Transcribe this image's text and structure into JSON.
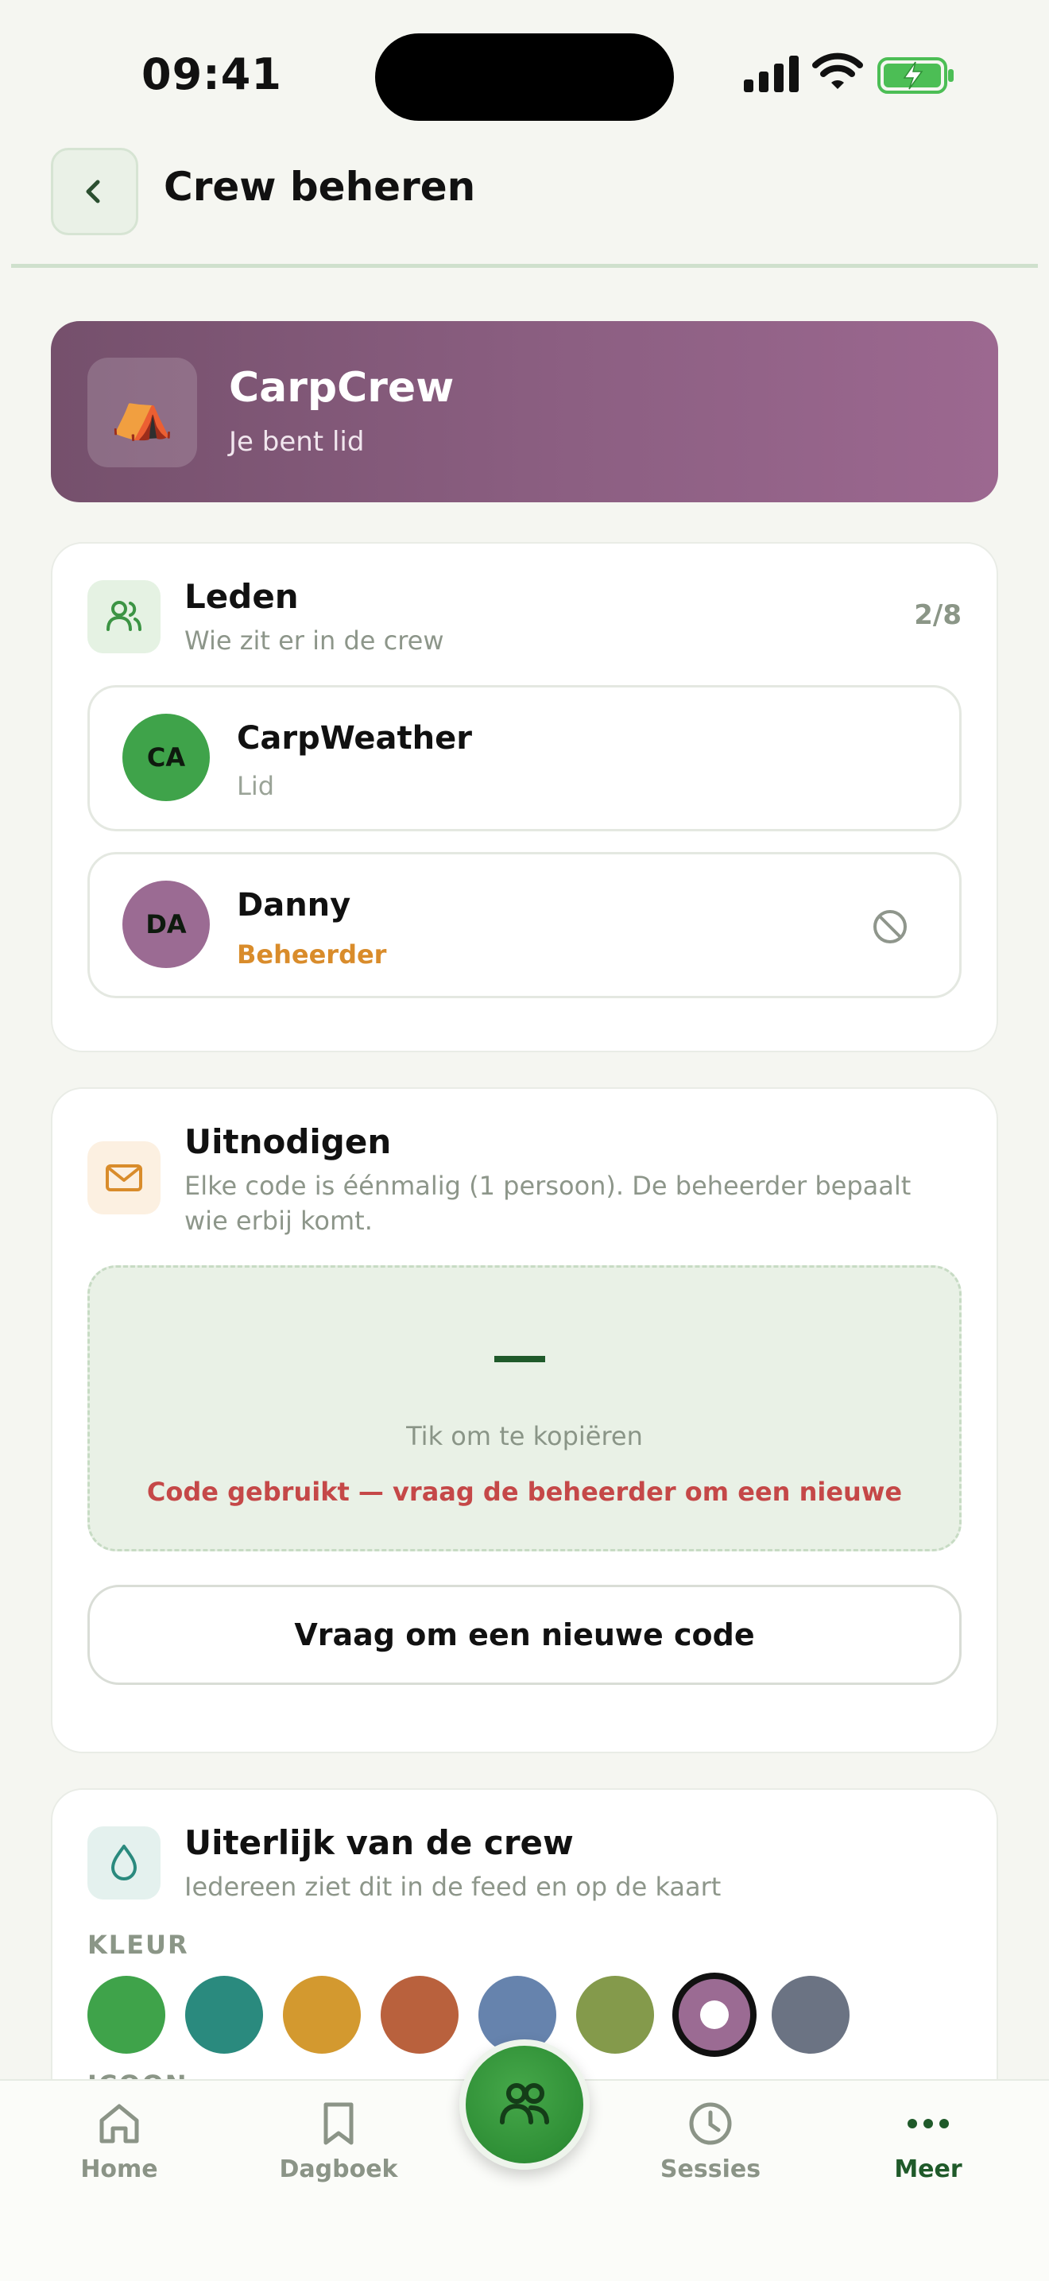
{
  "status_bar": {
    "time": "09:41"
  },
  "header": {
    "title": "Crew beheren"
  },
  "crew": {
    "icon": "⛺",
    "name": "CarpCrew",
    "subtitle": "Je bent lid",
    "gradient": [
      "#75506c",
      "#9c6890"
    ]
  },
  "members_section": {
    "title": "Leden",
    "subtitle": "Wie zit er in de crew",
    "count": "2/8",
    "members": [
      {
        "initials": "CA",
        "name": "CarpWeather",
        "role": "Lid",
        "avatar_color": "#3fa34a",
        "role_color": "#9aa397"
      },
      {
        "initials": "DA",
        "name": "Danny",
        "role": "Beheerder",
        "avatar_color": "#9b6b93",
        "role_color": "#d98c2b"
      }
    ]
  },
  "invite_section": {
    "title": "Uitnodigen",
    "subtitle": "Elke code is éénmalig (1 persoon). De beheerder bepaalt wie erbij komt.",
    "code": "—",
    "tap_hint": "Tik om te kopiëren",
    "used_message": "Code gebruikt — vraag de beheerder om een nieuwe",
    "new_code_button": "Vraag om een nieuwe code"
  },
  "appearance_section": {
    "title": "Uiterlijk van de crew",
    "subtitle": "Iedereen ziet dit in de feed en op de kaart",
    "color_label": "KLEUR",
    "icon_label": "ICOON",
    "colors": [
      "#3fa34a",
      "#2a8a7e",
      "#d3992f",
      "#b9613d",
      "#6683ad",
      "#849a4b",
      "#9b6b93",
      "#6b7383"
    ],
    "selected_color_index": 6
  },
  "tab_bar": {
    "items": [
      {
        "label": "Home",
        "icon": "home-icon"
      },
      {
        "label": "Dagboek",
        "icon": "bookmark-icon"
      },
      {
        "label": "Sessies",
        "icon": "clock-icon"
      },
      {
        "label": "Meer",
        "icon": "more-icon"
      }
    ],
    "center_icon": "crew-icon",
    "active": "Meer"
  }
}
